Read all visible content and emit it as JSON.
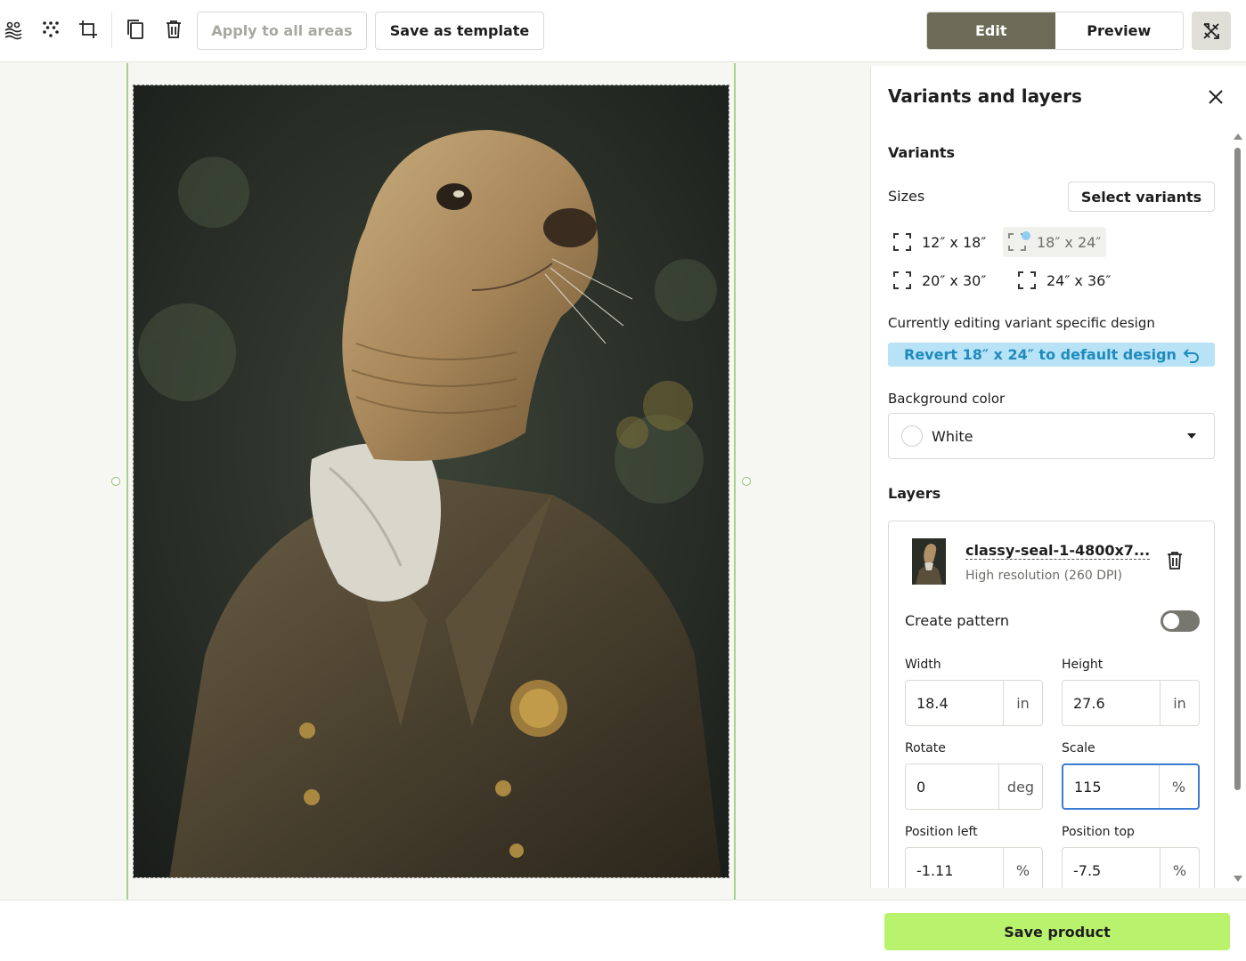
{
  "toolbar": {
    "icons": [
      "pattern-icon",
      "scatter-icon",
      "crop-icon",
      "copy-icon",
      "trash-icon"
    ],
    "apply_label": "Apply to all areas",
    "save_template_label": "Save as template",
    "mode_tabs": [
      {
        "label": "Edit",
        "active": true
      },
      {
        "label": "Preview",
        "active": false
      }
    ],
    "tools_icon": "tools-icon"
  },
  "panel": {
    "title": "Variants and layers",
    "variants_heading": "Variants",
    "sizes_label": "Sizes",
    "select_variants_label": "Select variants",
    "sizes": [
      {
        "label": "12″ x 18″",
        "selected": false
      },
      {
        "label": "18″ x 24″",
        "selected": true
      },
      {
        "label": "20″ x 30″",
        "selected": false
      },
      {
        "label": "24″ x 36″",
        "selected": false
      }
    ],
    "editing_note": "Currently editing variant specific design",
    "revert_label": "Revert 18″ x 24″ to default design",
    "bg_color_label": "Background color",
    "bg_color_value": "White",
    "layers_heading": "Layers",
    "layer": {
      "name": "classy-seal-1-4800x7...",
      "resolution": "High resolution (260 DPI)",
      "create_pattern_label": "Create pattern",
      "create_pattern_on": false,
      "width_label": "Width",
      "width_value": "18.4",
      "width_unit": "in",
      "height_label": "Height",
      "height_value": "27.6",
      "height_unit": "in",
      "rotate_label": "Rotate",
      "rotate_value": "0",
      "rotate_unit": "deg",
      "scale_label": "Scale",
      "scale_value": "115",
      "scale_unit": "%",
      "pos_left_label": "Position left",
      "pos_left_value": "-1.11",
      "pos_left_unit": "%",
      "pos_top_label": "Position top",
      "pos_top_value": "-7.5",
      "pos_top_unit": "%"
    }
  },
  "footer": {
    "save_label": "Save product"
  },
  "colors": {
    "accent_green": "#b9f36d",
    "edit_active": "#6b6b58",
    "revert_bg": "#b8e2f6",
    "revert_text": "#1f8bbd",
    "focus_blue": "#3b7bd1",
    "guide_green": "#a6d28a"
  }
}
